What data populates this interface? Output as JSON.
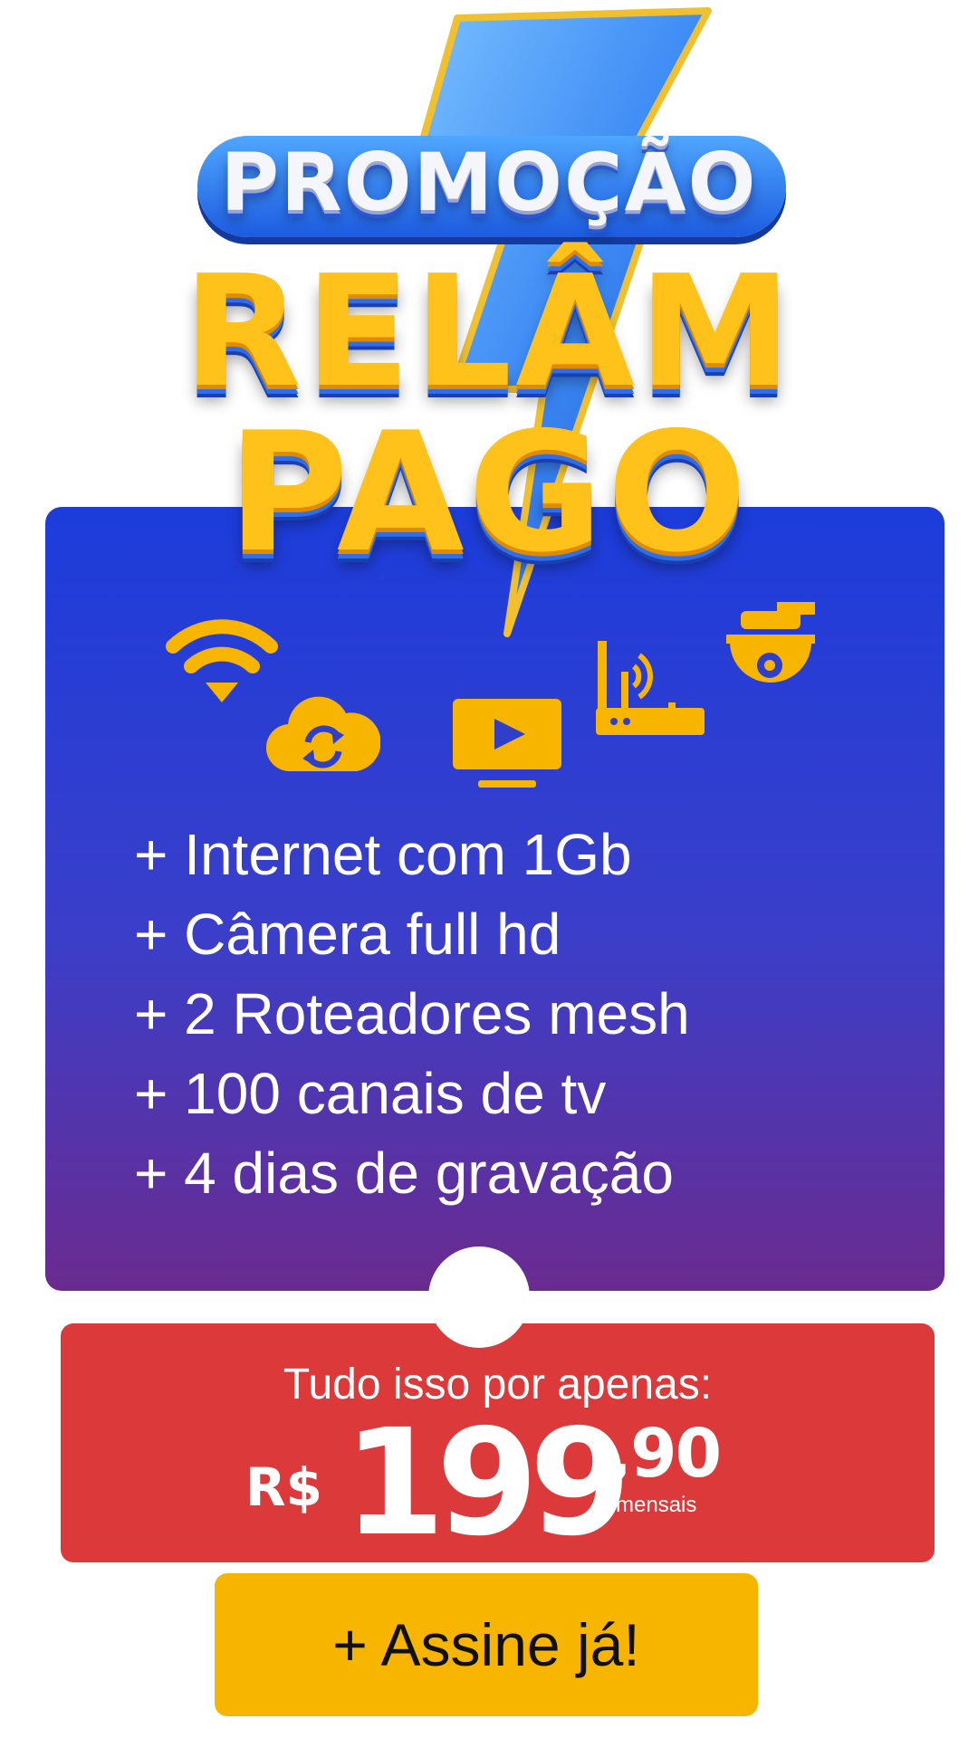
{
  "headline": {
    "line1": "PROMOÇÃO",
    "line2": "RELÂM",
    "line3": "PAGO"
  },
  "icons": [
    "wifi-icon",
    "cloud-sync-icon",
    "tv-play-icon",
    "router-icon",
    "security-camera-icon"
  ],
  "features": [
    "+ Internet com 1Gb",
    "+ Câmera full hd",
    "+ 2 Roteadores mesh",
    "+ 100 canais de tv",
    "+ 4 dias de gravação"
  ],
  "price": {
    "intro": "Tudo isso por apenas:",
    "currency": "R$",
    "integer": "199",
    "cents": ",90",
    "period": "mensais"
  },
  "cta": {
    "label": "+ Assine já!"
  },
  "colors": {
    "panel_top": "#1c3ddb",
    "panel_bottom": "#6a2b8f",
    "price_bg": "#dc3a3a",
    "cta_bg": "#f7b500",
    "icon_yellow": "#f7b500",
    "headline_yellow": "#ffc21a"
  }
}
